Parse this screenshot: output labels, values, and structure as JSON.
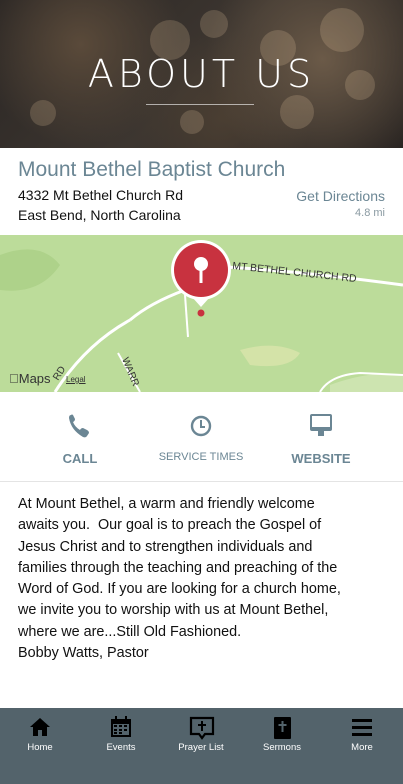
{
  "hero": {
    "title": "ABOUT US"
  },
  "church": {
    "name": "Mount Bethel Baptist Church",
    "address_line1": "4332 Mt Bethel Church Rd",
    "address_line2": "East Bend, North Carolina",
    "directions_label": "Get Directions",
    "distance": "4.8 mi"
  },
  "map": {
    "road_label_1": "MT BETHEL CHURCH RD",
    "road_label_2": "WARR",
    "road_label_3": "RD",
    "logo_text": "Maps",
    "legal_text": "Legal"
  },
  "actions": [
    {
      "label": "CALL",
      "icon": "phone-icon"
    },
    {
      "label": "SERVICE TIMES",
      "icon": "clock-icon"
    },
    {
      "label": "WEBSITE",
      "icon": "monitor-icon"
    }
  ],
  "description": {
    "lines": [
      "At Mount Bethel, a warm and friendly welcome",
      "awaits you.  Our goal is to preach the Gospel of",
      "Jesus Christ and to strengthen individuals and",
      "families through the teaching and preaching of the",
      "Word of God. If you are looking for a church home,",
      "we invite you to worship with us at Mount Bethel,",
      "where we are...Still Old Fashioned.",
      "Bobby Watts, Pastor"
    ]
  },
  "tabbar": {
    "items": [
      {
        "label": "Home",
        "icon": "home-icon"
      },
      {
        "label": "Events",
        "icon": "calendar-icon"
      },
      {
        "label": "Prayer List",
        "icon": "prayer-icon"
      },
      {
        "label": "Sermons",
        "icon": "bible-icon"
      },
      {
        "label": "More",
        "icon": "menu-icon"
      }
    ]
  },
  "colors": {
    "accent": "#6b8694",
    "pin": "#c8323f",
    "tabbar": "#53636b",
    "map_green": "#bcdc9a"
  }
}
